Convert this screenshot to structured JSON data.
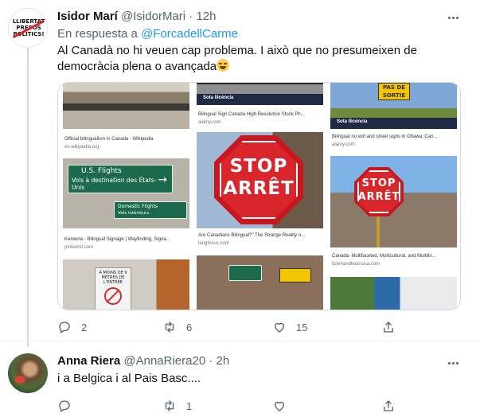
{
  "tweet1": {
    "avatar_text": "LLIBERTAT PRESOS POLÍTICS!",
    "name": "Isidor Marí",
    "handle": "@IsidorMari",
    "dot": "·",
    "time": "12h",
    "reply_prefix": "En respuesta a",
    "reply_to": "@ForcadellCarme",
    "text": "Al Canadà no hi veuen cap problema. I això que no presumeixen de democràcia plena o avançada",
    "emoji": "face-with-tears-of-joy",
    "media": {
      "col1": [
        {
          "caption": "Official bilingualism in Canada - Wikipedia",
          "source": "en.wikipedia.org"
        },
        {
          "sign_title": "U.S. Flights",
          "sign_sub": "Vols à destination des États-Unis",
          "sign2": "Domestic Flights",
          "sign2_sub": "Vols intérieurs",
          "caption": "Kelowna - Bilingual Signage | Wayfinding, Signa...",
          "source": "pinterest.com"
        },
        {
          "sign": "À MOINS DE 9 MÈTRES DE L'ENTRÉE"
        }
      ],
      "col2": [
        {
          "overlay": "Sota llicència",
          "caption": "Bilingual Sign Canada High Resolution Stock Ph...",
          "source": "alamy.com"
        },
        {
          "line1": "STOP",
          "line2": "ARRÊT",
          "caption": "Are Canadians Bilingual?\" The Strange Reality o...",
          "source": "langfocus.com"
        },
        {}
      ],
      "col3": [
        {
          "sign": "PAS DE SORTIE",
          "overlay": "Sota llicència",
          "caption": "Bilingual no exit and street signs in Ottawa, Can...",
          "source": "alamy.com"
        },
        {
          "line1": "STOP",
          "line2": "ARRÊT",
          "caption": "Canada: Multifaceted, Multicultural, and Multilin...",
          "source": "listenandlearnusa.com"
        },
        {}
      ]
    },
    "actions": {
      "reply": "2",
      "retweet": "6",
      "like": "15",
      "share": ""
    }
  },
  "tweet2": {
    "name": "Anna Riera",
    "handle": "@AnnaRiera20",
    "dot": "·",
    "time": "2h",
    "text": "i a Belgica i al Pais Basc....",
    "actions": {
      "reply": "",
      "retweet": "1",
      "like": "",
      "share": ""
    }
  },
  "colors": {
    "link": "#1d9bf0",
    "muted": "#536471",
    "text": "#0f1419",
    "border": "#cfd9de"
  }
}
